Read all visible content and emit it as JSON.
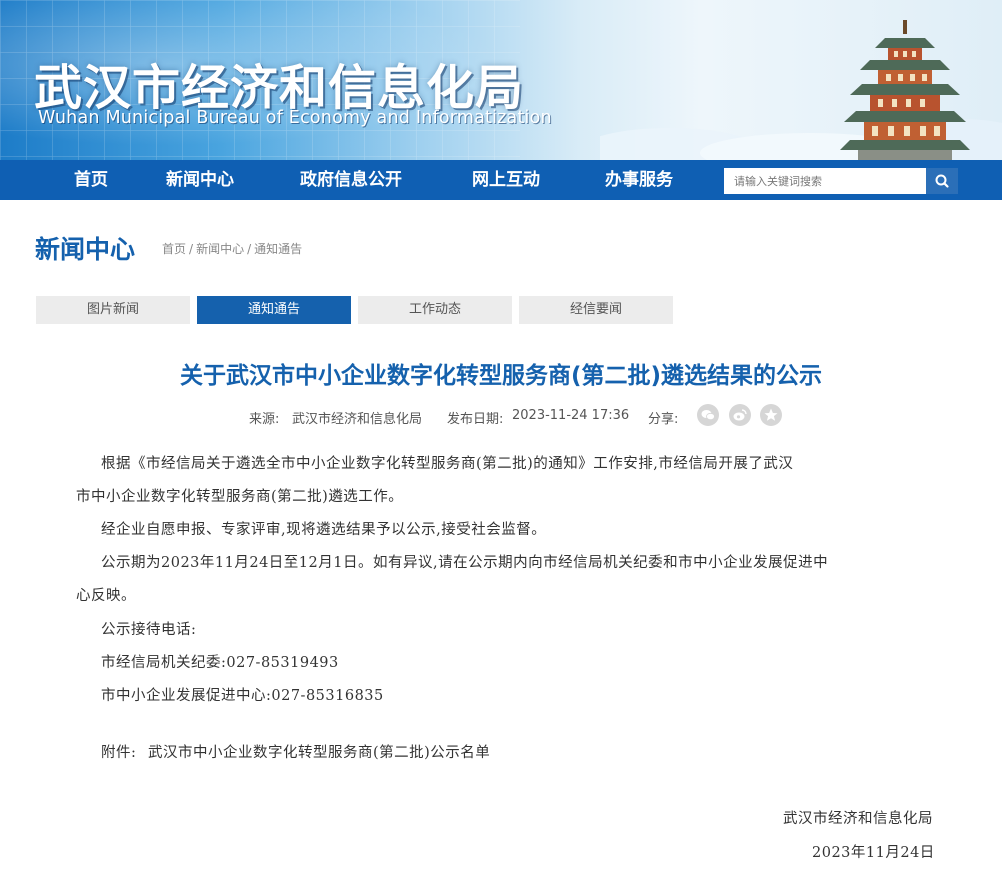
{
  "header": {
    "title_cn": "武汉市经济和信息化局",
    "title_en": "Wuhan Municipal Bureau of Economy and Informatization"
  },
  "nav": {
    "items": [
      "首页",
      "新闻中心",
      "政府信息公开",
      "网上互动",
      "办事服务"
    ],
    "search_placeholder": "请输入关键词搜索",
    "search_icon": "search-icon"
  },
  "section": {
    "title": "新闻中心",
    "breadcrumb": [
      "首页",
      "新闻中心",
      "通知通告"
    ],
    "breadcrumb_sep": "/"
  },
  "tabs": [
    {
      "label": "图片新闻",
      "active": false
    },
    {
      "label": "通知通告",
      "active": true
    },
    {
      "label": "工作动态",
      "active": false
    },
    {
      "label": "经信要闻",
      "active": false
    }
  ],
  "article": {
    "title": "关于武汉市中小企业数字化转型服务商(第二批)遴选结果的公示",
    "source_label": "来源:",
    "source": "武汉市经济和信息化局",
    "date_label": "发布日期:",
    "date": "2023-11-24 17:36",
    "share_label": "分享:",
    "share_icons": [
      "wechat-icon",
      "weibo-icon",
      "favorite-icon"
    ],
    "paragraphs": [
      "根据《市经信局关于遴选全市中小企业数字化转型服务商(第二批)的通知》工作安排,市经信局开展了武汉",
      "市中小企业数字化转型服务商(第二批)遴选工作。",
      "经企业自愿申报、专家评审,现将遴选结果予以公示,接受社会监督。",
      "公示期为2023年11月24日至12月1日。如有异议,请在公示期内向市经信局机关纪委和市中小企业发展促进中",
      "心反映。",
      "公示接待电话:",
      "市经信局机关纪委:027-85319493",
      "市中小企业发展促进中心:027-85316835"
    ],
    "attachment_label": "附件:",
    "attachment": "武汉市中小企业数字化转型服务商(第二批)公示名单",
    "signature": "武汉市经济和信息化局",
    "sign_date": "2023年11月24日"
  },
  "colors": {
    "brand_blue": "#1561ad",
    "nav_blue": "#0f5fb3",
    "tab_inactive": "#ececec"
  }
}
